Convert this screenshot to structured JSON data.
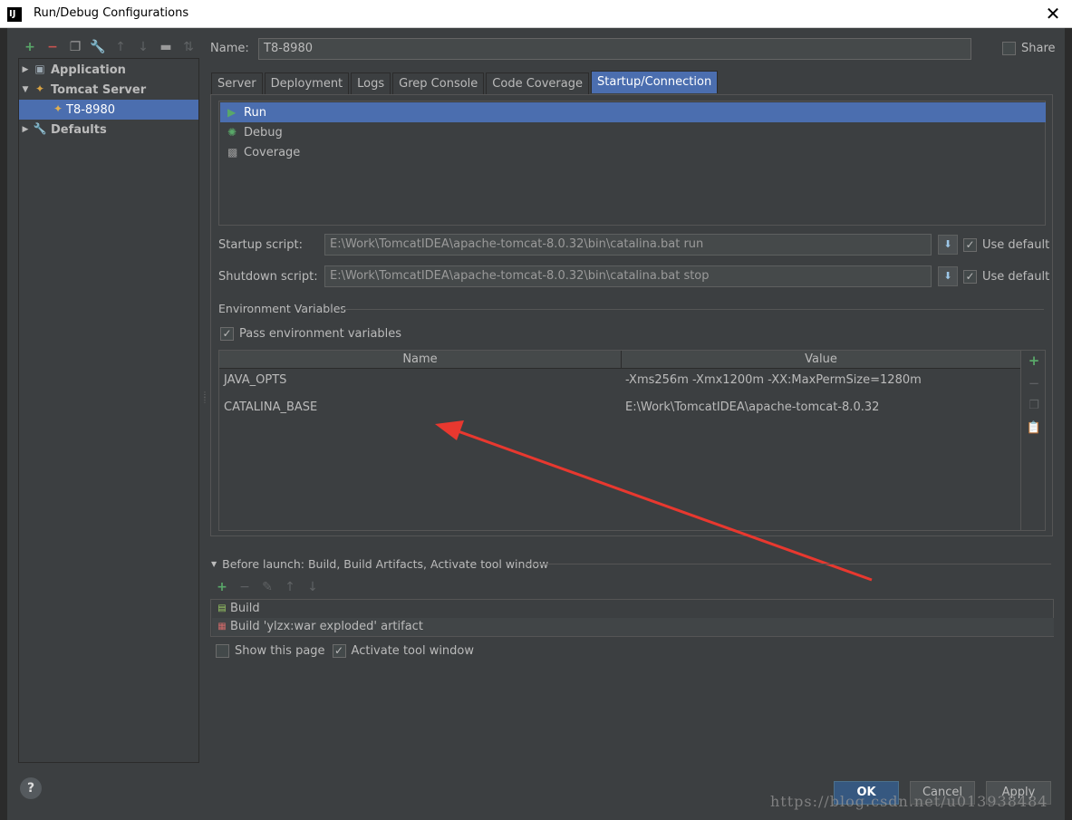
{
  "window": {
    "title": "Run/Debug Configurations",
    "app_icon_label": "IJ"
  },
  "left_toolbar": {
    "icons": [
      "add-icon",
      "remove-icon",
      "copy-icon",
      "wrench-icon",
      "move-up-icon",
      "move-down-icon",
      "folder-icon",
      "sort-icon"
    ]
  },
  "tree": {
    "items": [
      {
        "label": "Application",
        "icon": "application-icon",
        "expanded": false
      },
      {
        "label": "Tomcat Server",
        "icon": "tomcat-icon",
        "expanded": true
      },
      {
        "label": "T8-8980",
        "icon": "tomcat-icon",
        "selected": true
      },
      {
        "label": "Defaults",
        "icon": "wrench-icon",
        "expanded": false
      }
    ]
  },
  "name": {
    "label": "Name:",
    "value": "T8-8980"
  },
  "share": {
    "label": "Share",
    "checked": false
  },
  "tabs": [
    {
      "label": "Server"
    },
    {
      "label": "Deployment"
    },
    {
      "label": "Logs"
    },
    {
      "label": "Grep Console"
    },
    {
      "label": "Code Coverage"
    },
    {
      "label": "Startup/Connection",
      "active": true
    }
  ],
  "executors": [
    {
      "label": "Run",
      "icon": "run-icon",
      "selected": true
    },
    {
      "label": "Debug",
      "icon": "debug-icon"
    },
    {
      "label": "Coverage",
      "icon": "coverage-icon"
    }
  ],
  "startup_script": {
    "label": "Startup script:",
    "value": "E:\\Work\\TomcatIDEA\\apache-tomcat-8.0.32\\bin\\catalina.bat run",
    "use_default_label": "Use default",
    "use_default": true
  },
  "shutdown_script": {
    "label": "Shutdown script:",
    "value": "E:\\Work\\TomcatIDEA\\apache-tomcat-8.0.32\\bin\\catalina.bat stop",
    "use_default_label": "Use default",
    "use_default": true
  },
  "env": {
    "section_title": "Environment Variables",
    "pass_label": "Pass environment variables",
    "pass_checked": true,
    "columns": [
      "Name",
      "Value"
    ],
    "rows": [
      {
        "name": "JAVA_OPTS",
        "value": "-Xms256m -Xmx1200m -XX:MaxPermSize=1280m"
      },
      {
        "name": "CATALINA_BASE",
        "value": "E:\\Work\\TomcatIDEA\\apache-tomcat-8.0.32"
      }
    ]
  },
  "before_launch": {
    "title": "Before launch: Build, Build Artifacts, Activate tool window",
    "items": [
      {
        "label": "Build",
        "icon": "build-icon"
      },
      {
        "label": "Build 'ylzx:war exploded' artifact",
        "icon": "artifact-icon"
      }
    ],
    "show_page_label": "Show this page",
    "show_page_checked": false,
    "activate_label": "Activate tool window",
    "activate_checked": true
  },
  "buttons": {
    "ok": "OK",
    "cancel": "Cancel",
    "apply": "Apply",
    "help": "?"
  },
  "watermark": "https://blog.csdn.net/u013938484",
  "colors": {
    "selection": "#4b6eaf",
    "arrow": "#e8382f",
    "add": "#59a869"
  }
}
